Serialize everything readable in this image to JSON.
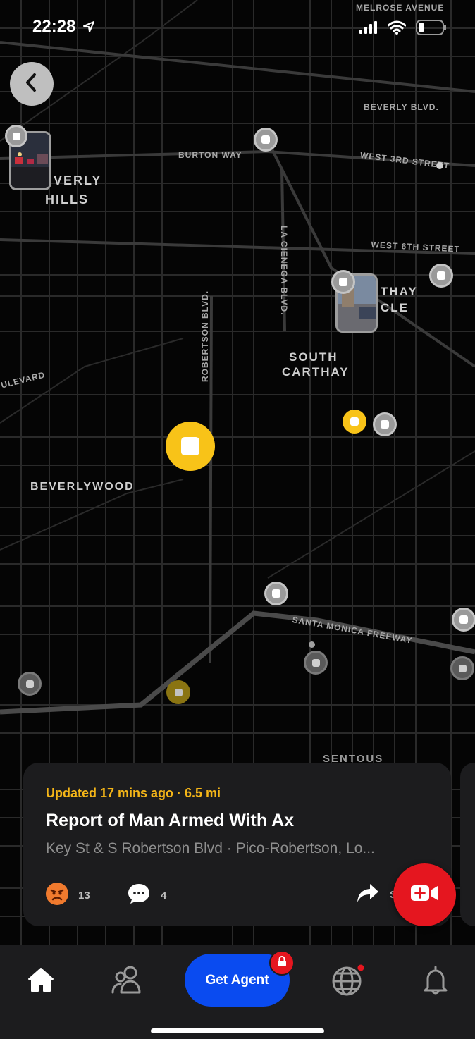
{
  "status_bar": {
    "time": "22:28",
    "icons": [
      "location-arrow-icon",
      "signal-icon",
      "wifi-icon",
      "battery-icon"
    ]
  },
  "map": {
    "areas": {
      "beverly_hills_line1": "VERLY",
      "beverly_hills_line2": "HILLS",
      "carthay_circle_line1": "THAY",
      "carthay_circle_line2": "CLE",
      "south_carthay_line1": "SOUTH",
      "south_carthay_line2": "CARTHAY",
      "beverlywood": "BEVERLYWOOD",
      "sentous": "SENTOUS"
    },
    "streets": {
      "melrose": "MELROSE AVENUE",
      "beverly_blvd": "BEVERLY BLVD.",
      "burton_way": "BURTON WAY",
      "west_3rd": "WEST 3RD STREET",
      "west_6th": "WEST 6TH STREET",
      "la_cienega": "LA CIENEGA BLVD.",
      "robertson": "ROBERTSON BLVD.",
      "boulevard": "ULEVARD",
      "santa_monica_fwy": "SANTA MONICA FREEWAY"
    }
  },
  "card": {
    "updated": "Updated 17 mins ago · 6.5 mi",
    "title": "Report of Man Armed With Ax",
    "location": "Key St & S Robertson Blvd · Pico-Robertson, Lo...",
    "reactions_count": "13",
    "comments_count": "4",
    "share_label": "S"
  },
  "tabbar": {
    "get_agent": "Get Agent"
  },
  "colors": {
    "accent_yellow": "#f8c318",
    "alert_red": "#e5161f",
    "agent_blue": "#0a4bf0"
  }
}
